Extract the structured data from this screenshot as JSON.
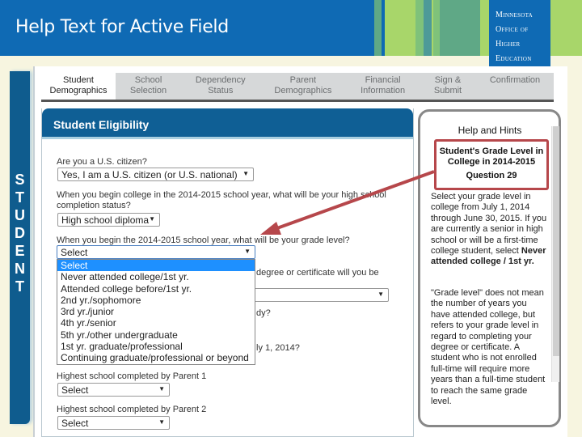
{
  "banner": {
    "title": "Help Text for Active Field",
    "logo_lines": [
      "Minnesota",
      "Office of",
      "Higher",
      "Education"
    ],
    "colors": {
      "blue": "#0f6ab4",
      "green_light": "#a8d66a",
      "green_dark": "#5fa886"
    }
  },
  "side_tab": {
    "letters": [
      "S",
      "T",
      "U",
      "D",
      "E",
      "N",
      "T"
    ]
  },
  "tabs": [
    {
      "label": "Student Demographics",
      "line1": "Student",
      "line2": "Demographics",
      "active": true
    },
    {
      "label": "School Selection",
      "line1": "School",
      "line2": "Selection",
      "active": false
    },
    {
      "label": "Dependency Status",
      "line1": "Dependency",
      "line2": "Status",
      "active": false
    },
    {
      "label": "Parent Demographics",
      "line1": "Parent",
      "line2": "Demographics",
      "active": false
    },
    {
      "label": "Financial Information",
      "line1": "Financial",
      "line2": "Information",
      "active": false
    },
    {
      "label": "Sign & Submit",
      "line1": "Sign &",
      "line2": "Submit",
      "active": false
    },
    {
      "label": "Confirmation",
      "line1": "Confirmation",
      "line2": "",
      "active": false
    }
  ],
  "form": {
    "section_title": "Student Eligibility",
    "q_citizen": "Are you a U.S. citizen?",
    "citizen_value": "Yes, I am a U.S. citizen (or U.S. national)",
    "q_hs_status_1": "When you begin college in the 2014-2015 school year, what will be your high school",
    "q_hs_status_2": "completion status?",
    "hs_status_value": "High school diploma",
    "q_grade_level": "When you begin the 2014-2015 school year, what will be your grade level?",
    "grade_level_value": "Select",
    "q_degree_partial": "degree or certificate will you be",
    "q_study_partial": "dy?",
    "q_date_partial": "ly 1, 2014?",
    "q_parent1": "Highest school completed by Parent 1",
    "parent1_value": "Select",
    "q_parent2": "Highest school completed by Parent 2",
    "parent2_value": "Select",
    "grade_options": [
      "Select",
      "Never attended college/1st yr.",
      "Attended college before/1st yr.",
      "2nd yr./sophomore",
      "3rd yr./junior",
      "4th yr./senior",
      "5th yr./other undergraduate",
      "1st yr. graduate/professional",
      "Continuing graduate/professional or beyond"
    ],
    "highlighted_option": "Select"
  },
  "help": {
    "title": "Help and Hints",
    "box_line1": "Student's Grade Level in",
    "box_line2": "College in 2014-2015",
    "box_line3": "Question 29",
    "para1": "Select your grade level in college from July 1, 2014 through June 30, 2015. If you are currently a senior in high school or will be a first-time college student, select",
    "para1_bold": "Never attended college / 1st yr.",
    "para2": "\"Grade level\" does not mean the number of years you have attended college, but refers to your grade level in regard to completing your degree or certificate. A student who is not enrolled full-time will require more years than a full-time student to reach the same grade level."
  }
}
